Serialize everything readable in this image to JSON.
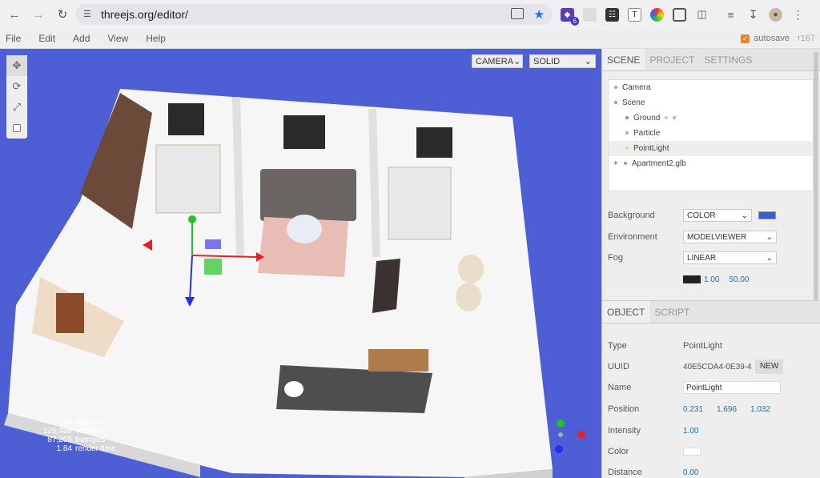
{
  "browser": {
    "url": "threejs.org/editor/",
    "ext_badge": "6"
  },
  "menubar": {
    "items": [
      "File",
      "Edit",
      "Add",
      "View",
      "Help"
    ],
    "autosave_label": "autosave",
    "revision": "r167"
  },
  "viewport": {
    "camera_select": "CAMERA",
    "shading_select": "SOLID",
    "info": [
      {
        "value": "180",
        "label": "objects"
      },
      {
        "value": "125,488",
        "label": "vertices"
      },
      {
        "value": "87,205",
        "label": "triangles"
      },
      {
        "value": "1.84",
        "label": "render time"
      }
    ]
  },
  "sidebar": {
    "tabs": [
      "SCENE",
      "PROJECT",
      "SETTINGS"
    ],
    "outliner": [
      {
        "label": "Camera"
      },
      {
        "label": "Scene"
      },
      {
        "label": "Ground"
      },
      {
        "label": "Particle"
      },
      {
        "label": "PointLight"
      },
      {
        "label": "Apartment2.glb",
        "expander": "+"
      }
    ],
    "background_label": "Background",
    "background_value": "COLOR",
    "background_color": "#3a5fcd",
    "environment_label": "Environment",
    "environment_value": "MODELVIEWER",
    "fog_label": "Fog",
    "fog_value": "LINEAR",
    "fog_color": "#222222",
    "fog_near": "1.00",
    "fog_far": "50.00",
    "object_tabs": [
      "OBJECT",
      "SCRIPT"
    ],
    "object": {
      "type_label": "Type",
      "type_value": "PointLight",
      "uuid_label": "UUID",
      "uuid_value": "40E5CDA4-0E39-4",
      "new_label": "NEW",
      "name_label": "Name",
      "name_value": "PointLight",
      "position_label": "Position",
      "position": [
        "0.231",
        "1.696",
        "1.032"
      ],
      "intensity_label": "Intensity",
      "intensity_value": "1.00",
      "color_label": "Color",
      "distance_label": "Distance",
      "distance_value": "0.00"
    }
  }
}
